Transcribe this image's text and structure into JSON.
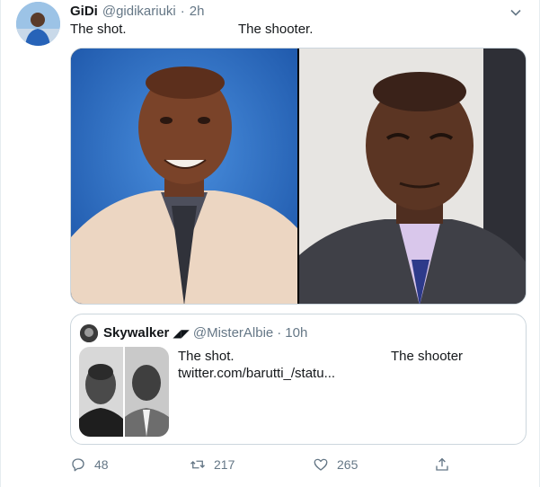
{
  "tweet": {
    "author_name": "GiDi",
    "author_handle": "@gidikariuki",
    "separator": "·",
    "time": "2h",
    "text_left": "The shot.",
    "text_right": "The shooter.",
    "media": [
      {
        "description": "portrait-blue-background",
        "bg": "#2f73c9"
      },
      {
        "description": "portrait-light-background",
        "bg": "#e9e7e4"
      }
    ]
  },
  "quoted": {
    "author_name": "Skywalker",
    "author_badge": "◢◤",
    "author_handle": "@MisterAlbie",
    "separator": "·",
    "time": "10h",
    "text_left": "The shot.",
    "text_right": "The shooter",
    "link": "twitter.com/barutti_/statu..."
  },
  "actions": {
    "reply_count": "48",
    "retweet_count": "217",
    "like_count": "265"
  },
  "icons": {
    "reply": "reply-icon",
    "retweet": "retweet-icon",
    "like": "heart-icon",
    "share": "share-icon",
    "caret": "chevron-down-icon"
  },
  "colors": {
    "secondary_text": "#657786",
    "border": "#ccd6dd"
  }
}
